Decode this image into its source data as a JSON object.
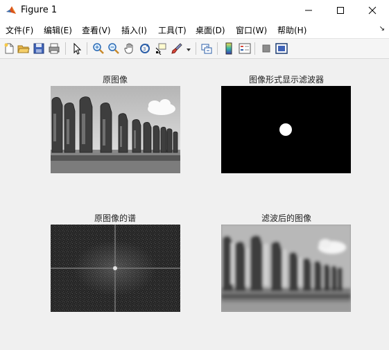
{
  "window": {
    "title": "Figure 1",
    "icon": "matlab-logo-icon"
  },
  "menubar": {
    "items": [
      "文件(F)",
      "编辑(E)",
      "查看(V)",
      "插入(I)",
      "工具(T)",
      "桌面(D)",
      "窗口(W)",
      "帮助(H)"
    ],
    "corner": "↘"
  },
  "toolbar": {
    "icons": [
      "new-figure-icon",
      "open-file-icon",
      "save-icon",
      "print-icon",
      "edit-plot-arrow-icon",
      "zoom-in-icon",
      "zoom-out-icon",
      "pan-hand-icon",
      "rotate-3d-icon",
      "data-cursor-icon",
      "brush-icon",
      "brush-dropdown-icon",
      "link-plot-icon",
      "insert-colorbar-icon",
      "insert-legend-icon",
      "hide-plot-tools-icon",
      "show-plot-tools-icon"
    ]
  },
  "subplots": [
    {
      "title": "原图像",
      "content": "grayscale photograph of moai statues"
    },
    {
      "title": "图像形式显示滤波器",
      "content": "black field with white disk at center"
    },
    {
      "title": "原图像的谱",
      "content": "noisy grayscale fourier spectrum with bright center cross"
    },
    {
      "title": "滤波后的图像",
      "content": "blurred grayscale photograph of moai statues"
    }
  ]
}
